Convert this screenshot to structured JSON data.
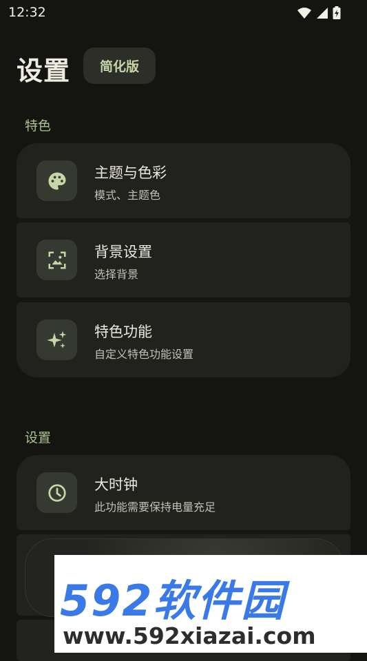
{
  "status_bar": {
    "time": "12:32"
  },
  "header": {
    "title": "设置",
    "chip_label": "简化版"
  },
  "sections": [
    {
      "label": "特色",
      "items": [
        {
          "title": "主题与色彩",
          "subtitle": "模式、主题色",
          "icon": "palette-icon"
        },
        {
          "title": "背景设置",
          "subtitle": "选择背景",
          "icon": "image-icon"
        },
        {
          "title": "特色功能",
          "subtitle": "自定义特色功能设置",
          "icon": "sparkle-icon"
        }
      ]
    },
    {
      "label": "设置",
      "items": [
        {
          "title": "大时钟",
          "subtitle": "此功能需要保持电量充足",
          "icon": "clock-icon"
        }
      ]
    }
  ],
  "watermark": {
    "title": "592软件园",
    "url": "www.592xiazai.com"
  },
  "colors": {
    "background": "#141411",
    "card": "#21221d",
    "accent": "#aac48a",
    "icon_tile": "#363930"
  }
}
